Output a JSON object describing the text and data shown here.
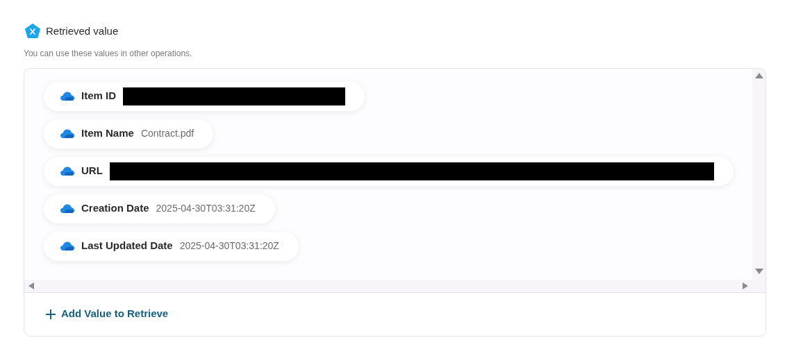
{
  "header": {
    "title": "Retrieved value",
    "subtitle": "You can use these values in other operations."
  },
  "values": [
    {
      "label": "Item ID",
      "kind": "redacted"
    },
    {
      "label": "Item Name",
      "kind": "text",
      "value": "Contract.pdf"
    },
    {
      "label": "URL",
      "kind": "redacted"
    },
    {
      "label": "Creation Date",
      "kind": "text",
      "value": "2025-04-30T03:31:20Z"
    },
    {
      "label": "Last Updated Date",
      "kind": "text",
      "value": "2025-04-30T03:31:20Z"
    }
  ],
  "add_button": {
    "label": "Add Value to Retrieve"
  }
}
